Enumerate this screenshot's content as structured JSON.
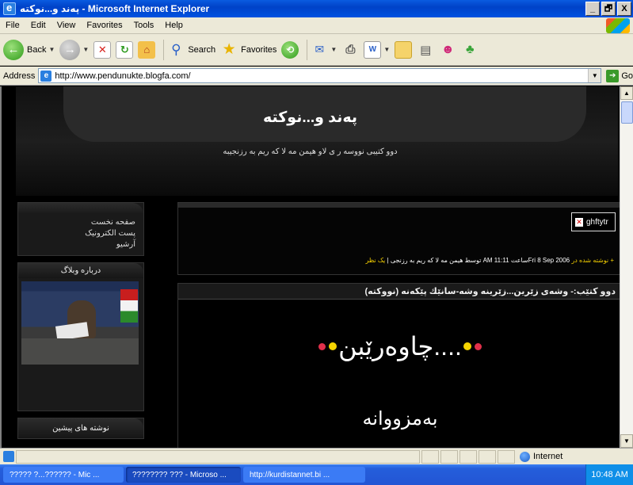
{
  "window": {
    "title": "پەند و...نوکتە - Microsoft Internet Explorer",
    "minimize": "_",
    "maximize": "🗗",
    "close": "X"
  },
  "menu": [
    "File",
    "Edit",
    "View",
    "Favorites",
    "Tools",
    "Help"
  ],
  "toolbar": {
    "back": "Back",
    "search": "Search",
    "favorites": "Favorites"
  },
  "address": {
    "label": "Address",
    "url": "http://www.pendunukte.blogfa.com/",
    "go": "Go"
  },
  "site": {
    "title": "پەند و...نوکتە",
    "subtitle": "دوو کتیبی نووسه ر ی لاو هیمن مه لا که ریم به رزنجیبه"
  },
  "sidebar": {
    "links": [
      "صفحه نخست",
      "پست الکترونیک",
      "آرشیو"
    ],
    "about_title": "درباره وبلاگ",
    "previous_title": "نوشته های پیشین"
  },
  "post": {
    "image_alt": "ghftytr",
    "meta": {
      "prefix": "+ نوشته شده در",
      "date": "Fri 8 Sep 2006",
      "time_label": "ساعت",
      "time": "11:11 AM",
      "author": "توسط هیمن مه لا که ریم به رزنجی",
      "sep": "|",
      "comments": "یک نظر"
    },
    "title": "دوو کتێب:- وشەی زێرین...زێرینە وشە-سانێك پێکەنە (نووکتە)",
    "big_line_1": "چاوەرێبن....",
    "big_line_2": "بەمزووانە"
  },
  "status": {
    "zone": "Internet"
  },
  "taskbar": {
    "tasks": [
      "????? ?...?????? - Mic ...",
      "???????? ??? - Microso ...",
      "http://kurdistannet.bi ..."
    ],
    "clock": "10:48 AM"
  }
}
